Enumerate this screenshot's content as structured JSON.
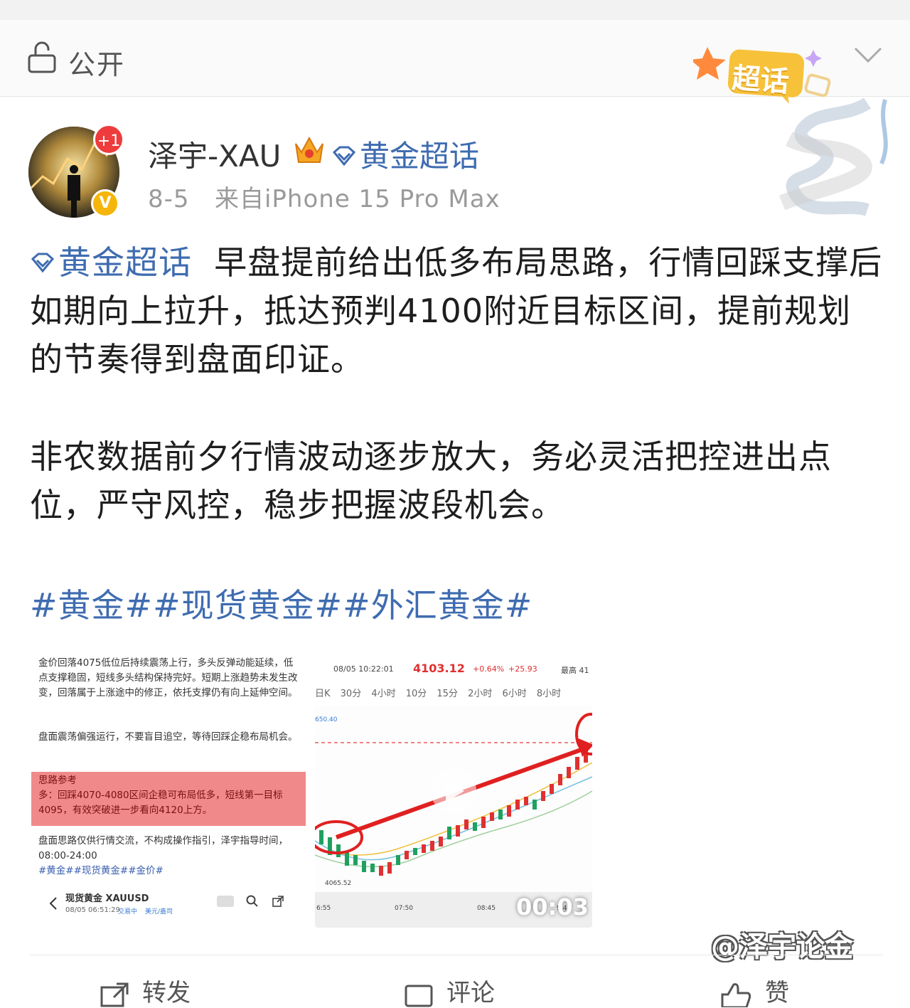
{
  "visibility": {
    "label": "公开"
  },
  "badge": {
    "label": "超话"
  },
  "author": {
    "name": "泽宇-XAU",
    "plus_badge": "+1",
    "verified_badge": "V",
    "topic_link": "黄金超话",
    "date": "8-5",
    "source": "来自iPhone 15 Pro Max"
  },
  "post": {
    "topic": "黄金超话",
    "para1": "早盘提前给出低多布局思路，行情回踩支撑后如期向上拉升，抵达预判4100附近目标区间，提前规划的节奏得到盘面印证。",
    "para2": "非农数据前夕行情波动逐步放大，务必灵活把控进出点位，严守风控，稳步把握波段机会。",
    "hashtags": "#黄金##现货黄金##外汇黄金#"
  },
  "image1": {
    "p1": "金价回落4075低位后持续震荡上行，多头反弹动能延续，低点支撑稳固，短线多头结构保持完好。短期上涨趋势未发生改变，回落属于上涨途中的修正，依托支撑仍有向上延伸空间。",
    "p2": "盘面震荡偏强运行，不要盲目追空，等待回踩企稳布局机会。",
    "box_title": "思路参考",
    "box_text": "多：回踩4070-4080区间企稳可布局低多，短线第一目标4095，有效突破进一步看向4120上方。",
    "p3": "盘面思路仅供行情交流，不构成操作指引，泽宇指导时间，08:00-24:00",
    "tags": "#黄金##现货黄金##金价#",
    "app_title": "现货黄金 XAUUSD",
    "app_time": "08/05 06:51:29",
    "app_tag1": "交易中",
    "app_tag2": "美元/盎司"
  },
  "image2": {
    "time": "08/05 10:22:01",
    "price": "4103.12",
    "pct": "+0.64%",
    "chg": "+25.93",
    "high_label": "最高 41",
    "timeframes": "日K 30分 4小时 10分 15分 2小时 6小时 8小时",
    "level_top": "650.40",
    "level_low": "4065.52",
    "x_labels": [
      "6:55",
      "07:50",
      "08:45",
      "9:40"
    ],
    "duration": "00:03"
  },
  "watermark": "@泽宇论金",
  "actions": {
    "repost": "转发",
    "comment": "评论",
    "like": "赞"
  }
}
